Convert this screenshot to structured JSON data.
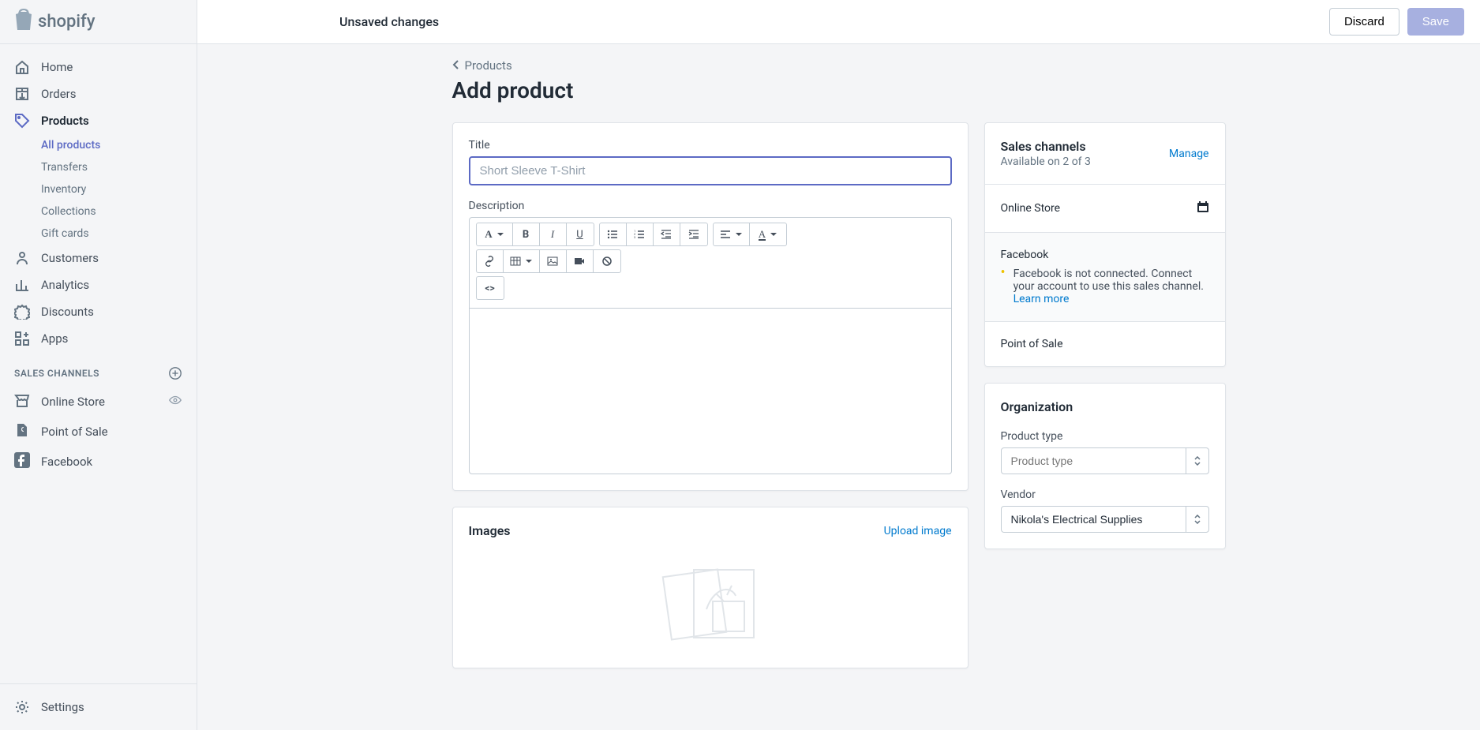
{
  "brand": "shopify",
  "topbar": {
    "status": "Unsaved changes",
    "discard": "Discard",
    "save": "Save"
  },
  "nav": {
    "home": "Home",
    "orders": "Orders",
    "products": "Products",
    "products_sub": {
      "all": "All products",
      "transfers": "Transfers",
      "inventory": "Inventory",
      "collections": "Collections",
      "giftcards": "Gift cards"
    },
    "customers": "Customers",
    "analytics": "Analytics",
    "discounts": "Discounts",
    "apps": "Apps",
    "section_sales": "SALES CHANNELS",
    "online_store": "Online Store",
    "pos": "Point of Sale",
    "facebook": "Facebook",
    "settings": "Settings"
  },
  "breadcrumb": "Products",
  "page_title": "Add product",
  "form": {
    "title_label": "Title",
    "title_placeholder": "Short Sleeve T-Shirt",
    "description_label": "Description",
    "images_heading": "Images",
    "upload_link": "Upload image"
  },
  "rte": {
    "font": "A",
    "bold": "B",
    "italic": "I",
    "underline": "U"
  },
  "sales_channels": {
    "heading": "Sales channels",
    "manage": "Manage",
    "availability": "Available on 2 of 3",
    "online_store": "Online Store",
    "facebook_label": "Facebook",
    "facebook_msg_a": "Facebook is not connected.",
    "facebook_msg_b": "Connect your account to use this sales channel.",
    "learn_more": "Learn more",
    "pos": "Point of Sale"
  },
  "organization": {
    "heading": "Organization",
    "product_type_label": "Product type",
    "product_type_placeholder": "Product type",
    "vendor_label": "Vendor",
    "vendor_value": "Nikola's Electrical Supplies"
  }
}
